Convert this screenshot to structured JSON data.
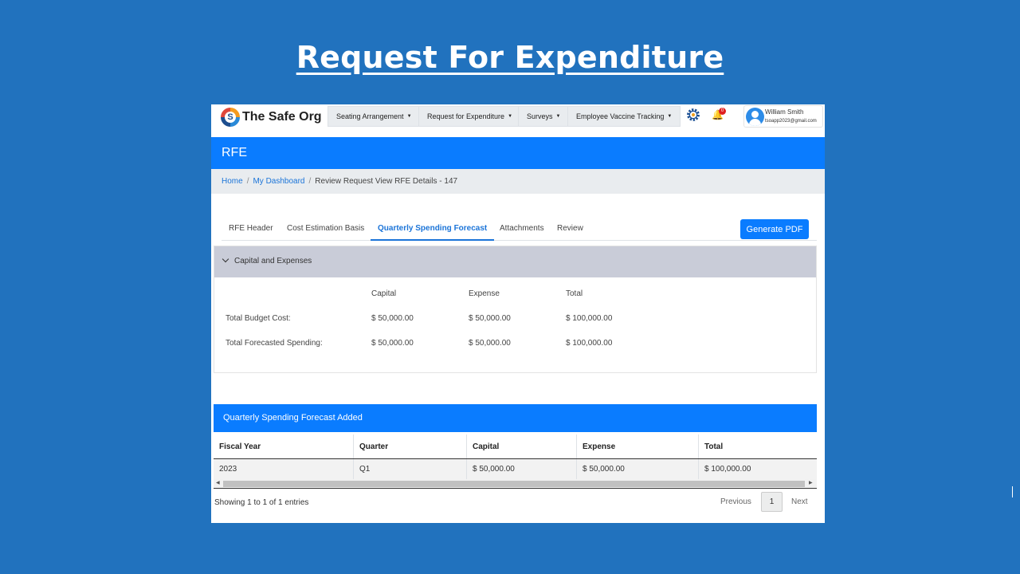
{
  "slide": {
    "title": "Request For Expenditure"
  },
  "navbar": {
    "logo_text": "The Safe Org",
    "logo_letter": "S",
    "menus": [
      "Seating Arrangement",
      "Request for Expenditure",
      "Surveys",
      "Employee Vaccine Tracking"
    ],
    "notification_count": "0",
    "user_name": "William Smith",
    "user_email": "tsoapp2023@gmail.com"
  },
  "page": {
    "header": "RFE"
  },
  "breadcrumb": {
    "home": "Home",
    "dashboard": "My Dashboard",
    "current": "Review Request View RFE Details - 147"
  },
  "tabs": [
    {
      "label": "RFE Header",
      "active": false
    },
    {
      "label": "Cost Estimation Basis",
      "active": false
    },
    {
      "label": "Quarterly Spending Forecast",
      "active": true
    },
    {
      "label": "Attachments",
      "active": false
    },
    {
      "label": "Review",
      "active": false
    }
  ],
  "generate_pdf": "Generate PDF",
  "capital_expenses": {
    "title": "Capital and Expenses",
    "columns": [
      "Capital",
      "Expense",
      "Total"
    ],
    "rows": [
      {
        "label": "Total Budget Cost:",
        "capital": "$ 50,000.00",
        "expense": "$ 50,000.00",
        "total": "$ 100,000.00"
      },
      {
        "label": "Total Forecasted Spending:",
        "capital": "$ 50,000.00",
        "expense": "$ 50,000.00",
        "total": "$ 100,000.00"
      }
    ]
  },
  "quarterly": {
    "title": "Quarterly Spending Forecast Added",
    "columns": [
      "Fiscal Year",
      "Quarter",
      "Capital",
      "Expense",
      "Total"
    ],
    "rows": [
      [
        "2023",
        "Q1",
        "$ 50,000.00",
        "$ 50,000.00",
        "$ 100,000.00"
      ]
    ],
    "showing": "Showing 1 to 1 of 1 entries",
    "previous": "Previous",
    "page": "1",
    "next": "Next"
  },
  "colors": {
    "background": "#2172be",
    "primary": "#0a7cff",
    "card_header": "#c9ccd8",
    "breadcrumb_bg": "#e9ecef"
  }
}
